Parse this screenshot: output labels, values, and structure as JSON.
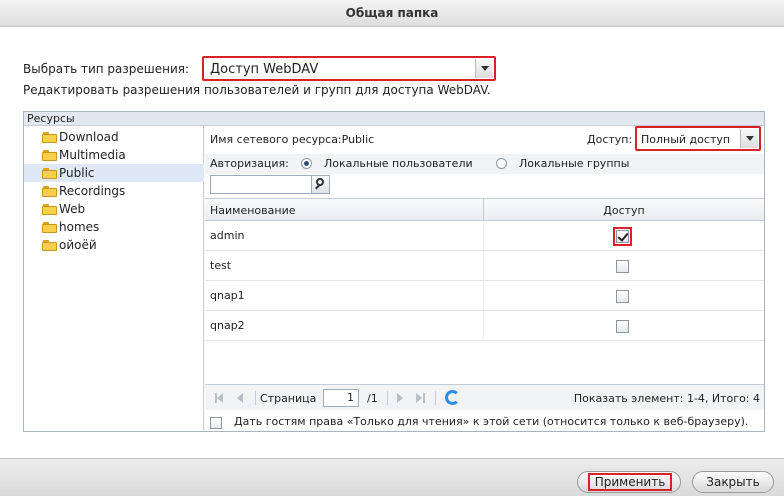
{
  "window": {
    "title": "Общая папка"
  },
  "permission_type": {
    "label": "Выбрать тип разрешения:",
    "selected": "Доступ WebDAV"
  },
  "description": "Редактировать разрешения пользователей и групп для доступа WebDAV.",
  "resources": {
    "header": "Ресурсы",
    "items": [
      {
        "label": "Download",
        "selected": false
      },
      {
        "label": "Multimedia",
        "selected": false
      },
      {
        "label": "Public",
        "selected": true
      },
      {
        "label": "Recordings",
        "selected": false
      },
      {
        "label": "Web",
        "selected": false
      },
      {
        "label": "homes",
        "selected": false
      },
      {
        "label": "ойоёй",
        "selected": false
      }
    ]
  },
  "share": {
    "network_name": "Имя сетевого ресурса:Public",
    "access_label": "Доступ:",
    "access_selected": "Полный доступ",
    "auth_label": "Авторизация:",
    "auth_options": [
      "Локальные пользователи",
      "Локальные группы"
    ],
    "auth_selected": "Локальные пользователи",
    "search_placeholder": ""
  },
  "table": {
    "columns": [
      "Наименование",
      "Доступ"
    ],
    "rows": [
      {
        "name": "admin",
        "access": true
      },
      {
        "name": "test",
        "access": false
      },
      {
        "name": "qnap1",
        "access": false
      },
      {
        "name": "qnap2",
        "access": false
      }
    ]
  },
  "pager": {
    "page_label": "Страница",
    "page_value": "1",
    "total_label": "/1",
    "info": "Показать элемент: 1-4, Итого: 4"
  },
  "guest": {
    "label": "Дать гостям права «Только для чтения» к этой сети (относится только к веб-браузеру).",
    "checked": false
  },
  "footer": {
    "apply_label": "Применить",
    "close_label": "Закрыть"
  },
  "colors": {
    "highlight": "#d8222a",
    "selection": "#dfe8f6",
    "refresh": "#2f8fe0"
  }
}
